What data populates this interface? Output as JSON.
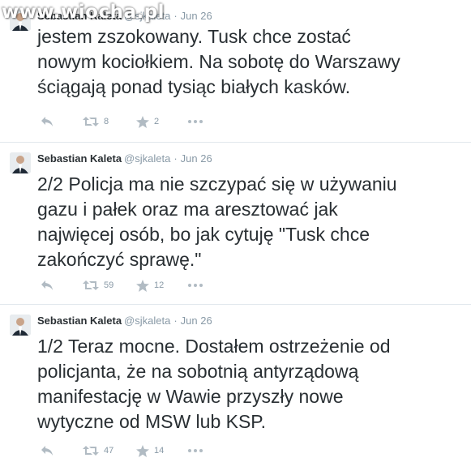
{
  "watermark": "www.wiocha.pl",
  "colors": {
    "text": "#292f33",
    "muted": "#8899a6",
    "icons": "#b1bbc3",
    "divider": "#e1e8ed"
  },
  "tweets": [
    {
      "fullname": "Sebastian Kaleta",
      "username": "@sjkaleta",
      "time": "Jun 26",
      "text": "jestem zszokowany. Tusk chce zostać\nnowym kociołkiem. Na sobotę do Warszawy\nściągają ponad tysiąc białych kasków.",
      "retweets": "8",
      "favorites": "2"
    },
    {
      "fullname": "Sebastian Kaleta",
      "username": "@sjkaleta",
      "time": "Jun 26",
      "text": "2/2 Policja ma nie szczypać się w używaniu\ngazu i pałek oraz ma aresztować jak\nnajwięcej osób, bo jak cytuję \"Tusk chce\nzakończyć sprawę.\"",
      "retweets": "59",
      "favorites": "12"
    },
    {
      "fullname": "Sebastian Kaleta",
      "username": "@sjkaleta",
      "time": "Jun 26",
      "text": "1/2 Teraz mocne. Dostałem ostrzeżenie od\npolicjanta, że na sobotnią antyrządową\nmanifestację w Wawie przyszły nowe\nwytyczne od MSW lub KSP.",
      "retweets": "47",
      "favorites": "14"
    }
  ],
  "icons": {
    "reply": "reply-icon",
    "retweet": "retweet-icon",
    "favorite": "star-icon",
    "more": "more-icon"
  }
}
